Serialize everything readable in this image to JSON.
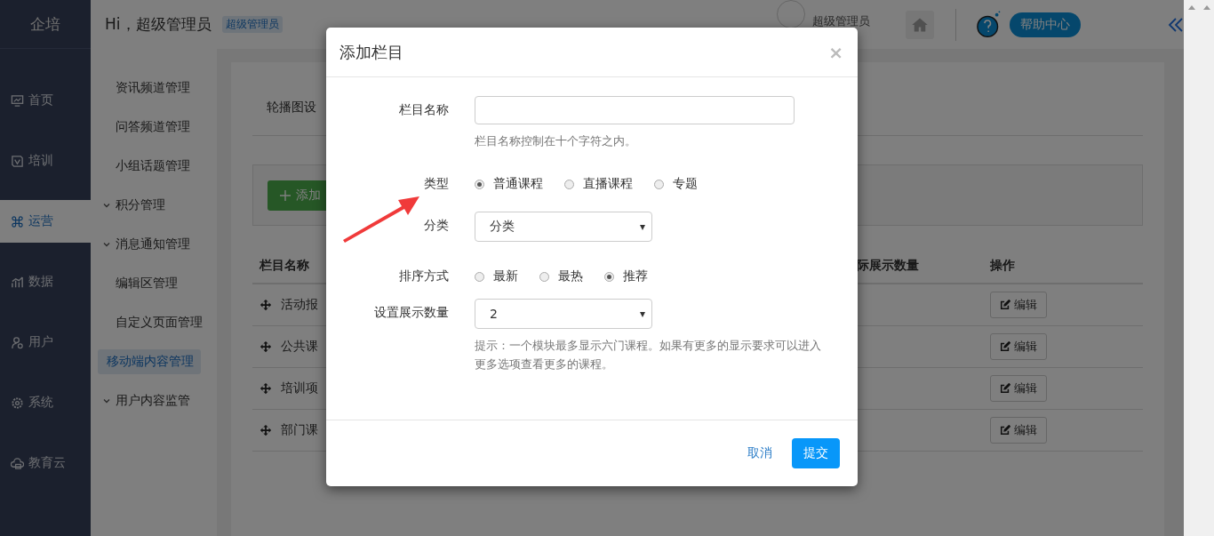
{
  "sidebar": {
    "brand": "企培",
    "items": [
      {
        "label": "首页",
        "selected": false
      },
      {
        "label": "培训",
        "selected": false
      },
      {
        "label": "运营",
        "selected": true
      },
      {
        "label": "数据",
        "selected": false
      },
      {
        "label": "用户",
        "selected": false
      },
      {
        "label": "系统",
        "selected": false
      },
      {
        "label": "教育云",
        "selected": false
      }
    ]
  },
  "header": {
    "greeting": "Hi，超级管理员",
    "role_badge": "超级管理员",
    "user_name": "超级管理员",
    "help_button": "帮助中心"
  },
  "submenu": {
    "items": [
      {
        "label": "资讯频道管理",
        "kind": "link",
        "selected": false
      },
      {
        "label": "问答频道管理",
        "kind": "link",
        "selected": false
      },
      {
        "label": "小组话题管理",
        "kind": "link",
        "selected": false
      },
      {
        "label": "积分管理",
        "kind": "group",
        "selected": false
      },
      {
        "label": "消息通知管理",
        "kind": "group",
        "selected": false
      },
      {
        "label": "编辑区管理",
        "kind": "link",
        "selected": false
      },
      {
        "label": "自定义页面管理",
        "kind": "link",
        "selected": false
      },
      {
        "label": "移动端内容管理",
        "kind": "link",
        "selected": true
      },
      {
        "label": "用户内容监管",
        "kind": "group",
        "selected": false
      }
    ]
  },
  "content": {
    "tab": "轮播图设",
    "add_button": "添加",
    "table": {
      "columns": [
        "栏目名称",
        "际展示数量",
        "操作"
      ],
      "rows": [
        {
          "name": "活动报",
          "action": "编辑"
        },
        {
          "name": "公共课",
          "action": "编辑"
        },
        {
          "name": "培训项",
          "action": "编辑"
        },
        {
          "name": "部门课",
          "action": "编辑"
        }
      ]
    }
  },
  "dialog": {
    "title": "添加栏目",
    "close": "×",
    "fields": [
      {
        "kind": "text",
        "label": "栏目名称",
        "help": "栏目名称控制在十个字符之内。"
      },
      {
        "kind": "radio",
        "label": "类型",
        "options": [
          {
            "label": "普通课程",
            "selected": true
          },
          {
            "label": "直播课程",
            "selected": false
          },
          {
            "label": "专题",
            "selected": false
          }
        ]
      },
      {
        "kind": "select",
        "label": "分类",
        "value": "分类"
      },
      {
        "kind": "radio",
        "label": "排序方式",
        "options": [
          {
            "label": "最新",
            "selected": false
          },
          {
            "label": "最热",
            "selected": false
          },
          {
            "label": "推荐",
            "selected": true
          }
        ]
      },
      {
        "kind": "select",
        "label": "设置展示数量",
        "value": "2",
        "help": "提示：一个模块最多显示六门课程。如果有更多的显示要求可以进入更多选项查看更多的课程。"
      }
    ],
    "cancel": "取消",
    "submit": "提交"
  }
}
